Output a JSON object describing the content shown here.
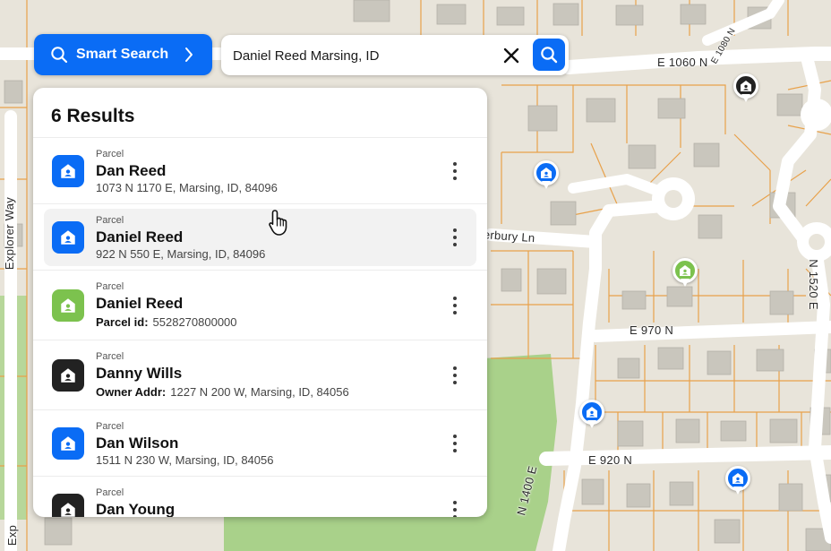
{
  "colors": {
    "accent": "#0a6cf5",
    "parcel_blue": "#0a6cf5",
    "parcel_green": "#7cc24e",
    "parcel_dark": "#222222",
    "map_bg": "#e8e4da",
    "road": "#ffffff",
    "parcel_line": "#e8a14a",
    "park": "#a9d18a"
  },
  "toolbar": {
    "smart_search_label": "Smart Search",
    "search_value": "Daniel Reed Marsing, ID",
    "search_placeholder": "Search"
  },
  "map": {
    "street_labels": {
      "e1060n": "E 1060 N",
      "explorer": "Explorer Way",
      "explorer_bottom": "Exp",
      "canterbury": "terbury Ln",
      "e970n": "E 970 N",
      "e920n": "E 920 N",
      "n1400e": "N 1400 E",
      "n1520e": "N 1520 E",
      "top_diag": "E 1080 N"
    },
    "pins": [
      {
        "name": "pin-dark-1",
        "color": "dark"
      },
      {
        "name": "pin-blue-1",
        "color": "blue"
      },
      {
        "name": "pin-green-1",
        "color": "green"
      },
      {
        "name": "pin-blue-2",
        "color": "blue"
      },
      {
        "name": "pin-blue-3",
        "color": "blue"
      }
    ]
  },
  "results": {
    "title": "6 Results",
    "count": 6,
    "items": [
      {
        "type": "Parcel",
        "name": "Dan Reed",
        "sub_label": "",
        "sub": "1073 N 1170 E, Marsing, ID, 84096",
        "icon_color": "blue",
        "icon": "parcel-home-icon",
        "highlighted": false
      },
      {
        "type": "Parcel",
        "name": "Daniel Reed",
        "sub_label": "",
        "sub": "922 N 550 E, Marsing, ID, 84096",
        "icon_color": "blue",
        "icon": "parcel-home-icon",
        "highlighted": true
      },
      {
        "type": "Parcel",
        "name": "Daniel Reed",
        "sub_label": "Parcel id:",
        "sub": "5528270800000",
        "icon_color": "green",
        "icon": "parcel-home-icon",
        "highlighted": false
      },
      {
        "type": "Parcel",
        "name": "Danny Wills",
        "sub_label": "Owner Addr:",
        "sub": "1227 N 200 W, Marsing, ID, 84056",
        "icon_color": "dark",
        "icon": "parcel-home-icon",
        "highlighted": false
      },
      {
        "type": "Parcel",
        "name": "Dan Wilson",
        "sub_label": "",
        "sub": "1511 N 230 W, Marsing, ID, 84056",
        "icon_color": "blue",
        "icon": "parcel-home-icon",
        "highlighted": false
      },
      {
        "type": "Parcel",
        "name": "Dan Young",
        "sub_label": "",
        "sub": "",
        "icon_color": "dark",
        "icon": "parcel-home-icon",
        "highlighted": false
      }
    ]
  }
}
